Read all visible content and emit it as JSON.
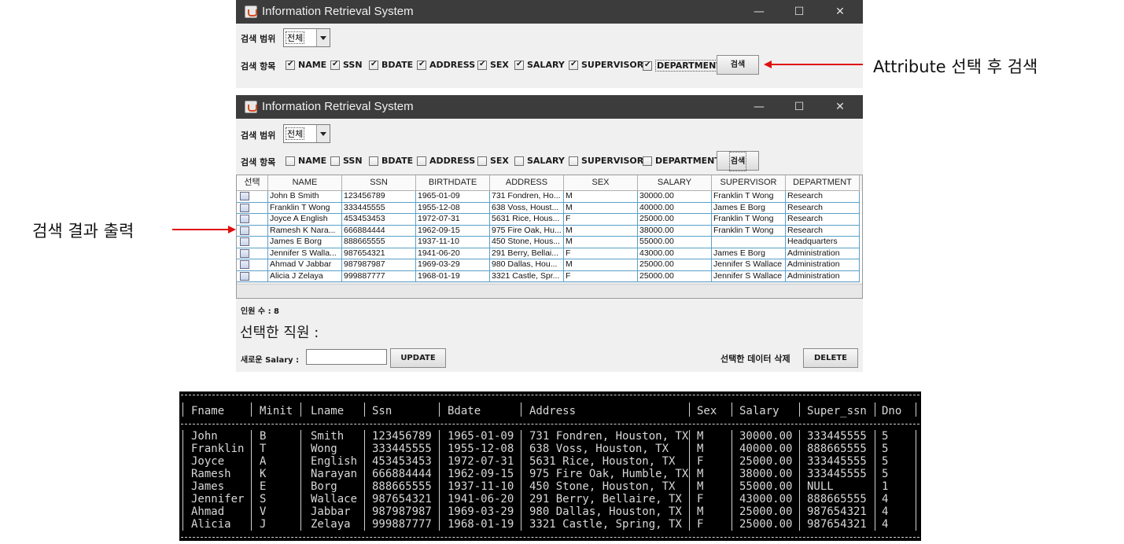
{
  "window1": {
    "title": "Information Retrieval System",
    "controls": {
      "minimize": "—",
      "maximize": "☐",
      "close": "✕"
    },
    "scope_label": "검색 범위",
    "scope_value": "전체",
    "items_label": "검색 항목",
    "checkboxes": [
      {
        "label": "NAME",
        "checked": true
      },
      {
        "label": "SSN",
        "checked": true
      },
      {
        "label": "BDATE",
        "checked": true
      },
      {
        "label": "ADDRESS",
        "checked": true
      },
      {
        "label": "SEX",
        "checked": true
      },
      {
        "label": "SALARY",
        "checked": true
      },
      {
        "label": "SUPERVISOR",
        "checked": true
      },
      {
        "label": "DEPARTMENT",
        "checked": true
      }
    ],
    "search_button": "검색"
  },
  "window2": {
    "title": "Information Retrieval System",
    "controls": {
      "minimize": "—",
      "maximize": "☐",
      "close": "✕"
    },
    "scope_label": "검색 범위",
    "scope_value": "전체",
    "items_label": "검색 항목",
    "checkboxes": [
      {
        "label": "NAME",
        "checked": false
      },
      {
        "label": "SSN",
        "checked": false
      },
      {
        "label": "BDATE",
        "checked": false
      },
      {
        "label": "ADDRESS",
        "checked": false
      },
      {
        "label": "SEX",
        "checked": false
      },
      {
        "label": "SALARY",
        "checked": false
      },
      {
        "label": "SUPERVISOR",
        "checked": false
      },
      {
        "label": "DEPARTMENT",
        "checked": false
      }
    ],
    "search_button": "검색",
    "table": {
      "columns": [
        "선택",
        "NAME",
        "SSN",
        "BIRTHDATE",
        "ADDRESS",
        "SEX",
        "SALARY",
        "SUPERVISOR",
        "DEPARTMENT"
      ],
      "rows": [
        [
          "",
          "John B Smith",
          "123456789",
          "1965-01-09",
          "731 Fondren, Ho...",
          "M",
          "30000.00",
          "Franklin T Wong",
          "Research"
        ],
        [
          "",
          "Franklin T Wong",
          "333445555",
          "1955-12-08",
          "638 Voss, Houst...",
          "M",
          "40000.00",
          "James E Borg",
          "Research"
        ],
        [
          "",
          "Joyce A English",
          "453453453",
          "1972-07-31",
          "5631 Rice, Hous...",
          "F",
          "25000.00",
          "Franklin T Wong",
          "Research"
        ],
        [
          "",
          "Ramesh K Nara...",
          "666884444",
          "1962-09-15",
          "975 Fire Oak, Hu...",
          "M",
          "38000.00",
          "Franklin T Wong",
          "Research"
        ],
        [
          "",
          "James E Borg",
          "888665555",
          "1937-11-10",
          "450 Stone, Hous...",
          "M",
          "55000.00",
          "",
          "Headquarters"
        ],
        [
          "",
          "Jennifer S Walla...",
          "987654321",
          "1941-06-20",
          "291 Berry, Bellai...",
          "F",
          "43000.00",
          "James E Borg",
          "Administration"
        ],
        [
          "",
          "Ahmad V Jabbar",
          "987987987",
          "1969-03-29",
          "980 Dallas, Hou...",
          "M",
          "25000.00",
          "Jennifer S Wallace",
          "Administration"
        ],
        [
          "",
          "Alicia J Zelaya",
          "999887777",
          "1968-01-19",
          "3321 Castle, Spr...",
          "F",
          "25000.00",
          "Jennifer S Wallace",
          "Administration"
        ]
      ]
    },
    "count_label": "인원 수 : 8",
    "selected_label": "선택한 직원 :",
    "new_salary_label": "새로운 Salary :",
    "new_salary_value": "",
    "update_button": "UPDATE",
    "delete_label": "선택한 데이터 삭제",
    "delete_button": "DELETE"
  },
  "annotations": {
    "search_note": "Attribute 선택 후 검색",
    "result_note": "검색 결과 출력"
  },
  "colors": {
    "arrow": "#e01010",
    "titlebar": "#3c3c3c",
    "console_bg": "#000000"
  },
  "console": {
    "headers": [
      "Fname",
      "Minit",
      "Lname",
      "Ssn",
      "Bdate",
      "Address",
      "Sex",
      "Salary",
      "Super_ssn",
      "Dno"
    ],
    "rows": [
      [
        "John",
        "B",
        "Smith",
        "123456789",
        "1965-01-09",
        "731 Fondren, Houston, TX",
        "M",
        "30000.00",
        "333445555",
        "5"
      ],
      [
        "Franklin",
        "T",
        "Wong",
        "333445555",
        "1955-12-08",
        "638 Voss, Houston, TX",
        "M",
        "40000.00",
        "888665555",
        "5"
      ],
      [
        "Joyce",
        "A",
        "English",
        "453453453",
        "1972-07-31",
        "5631 Rice, Houston, TX",
        "F",
        "25000.00",
        "333445555",
        "5"
      ],
      [
        "Ramesh",
        "K",
        "Narayan",
        "666884444",
        "1962-09-15",
        "975 Fire Oak, Humble, TX",
        "M",
        "38000.00",
        "333445555",
        "5"
      ],
      [
        "James",
        "E",
        "Borg",
        "888665555",
        "1937-11-10",
        "450 Stone, Houston, TX",
        "M",
        "55000.00",
        "NULL",
        "1"
      ],
      [
        "Jennifer",
        "S",
        "Wallace",
        "987654321",
        "1941-06-20",
        "291 Berry, Bellaire, TX",
        "F",
        "43000.00",
        "888665555",
        "4"
      ],
      [
        "Ahmad",
        "V",
        "Jabbar",
        "987987987",
        "1969-03-29",
        "980 Dallas, Houston, TX",
        "M",
        "25000.00",
        "987654321",
        "4"
      ],
      [
        "Alicia",
        "J",
        "Zelaya",
        "999887777",
        "1968-01-19",
        "3321 Castle, Spring, TX",
        "F",
        "25000.00",
        "987654321",
        "4"
      ]
    ]
  }
}
